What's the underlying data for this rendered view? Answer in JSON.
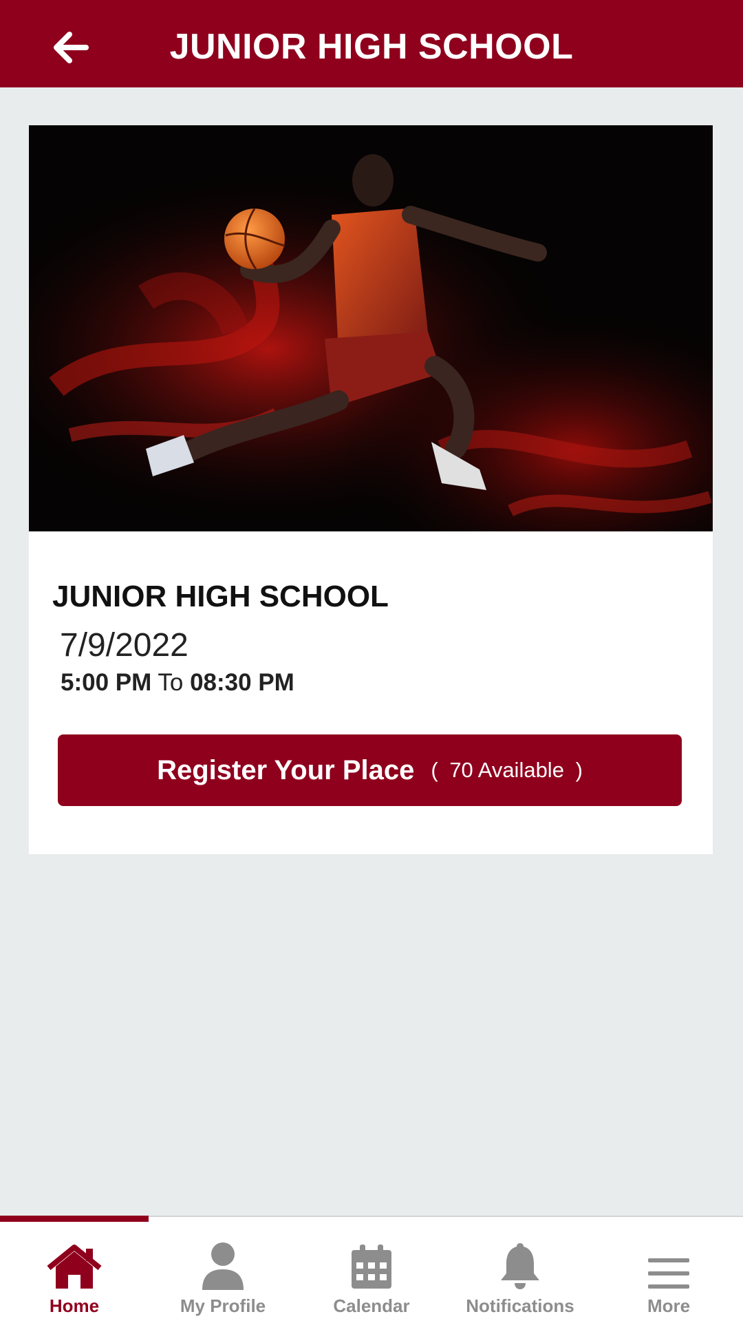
{
  "header": {
    "title": "JUNIOR HIGH SCHOOL",
    "back_icon": "arrow-left-icon"
  },
  "event": {
    "title": "JUNIOR HIGH SCHOOL",
    "date": "7/9/2022",
    "start_time": "5:00 PM",
    "time_separator": "To",
    "end_time": "08:30 PM",
    "register_label": "Register Your Place",
    "available_open": "(",
    "available_text": "70 Available",
    "available_close": ")"
  },
  "nav": {
    "items": [
      {
        "label": "Home",
        "icon": "home-icon",
        "active": true
      },
      {
        "label": "My Profile",
        "icon": "user-icon",
        "active": false
      },
      {
        "label": "Calendar",
        "icon": "calendar-icon",
        "active": false
      },
      {
        "label": "Notifications",
        "icon": "bell-icon",
        "active": false
      },
      {
        "label": "More",
        "icon": "menu-icon",
        "active": false
      }
    ]
  },
  "colors": {
    "brand": "#8f001d",
    "background": "#e9eced",
    "nav_inactive": "#8d8d8d"
  }
}
